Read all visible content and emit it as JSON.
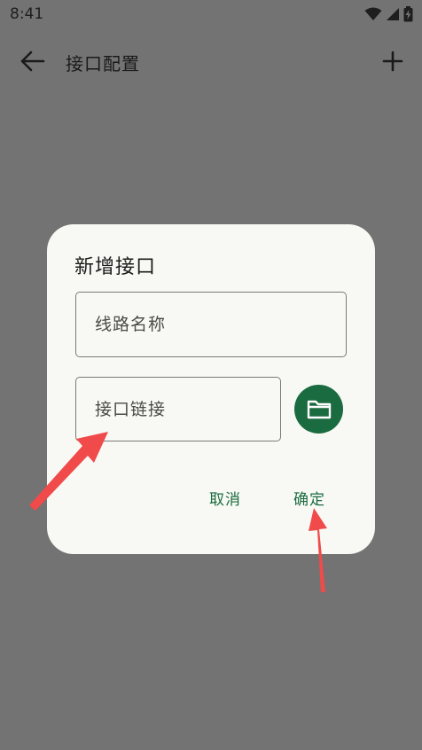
{
  "status_bar": {
    "time": "8:41",
    "icons": [
      "wifi-icon",
      "signal-icon",
      "battery-icon"
    ]
  },
  "app_bar": {
    "title": "接口配置",
    "back_icon": "arrow-left-icon",
    "add_icon": "plus-icon"
  },
  "dialog": {
    "title": "新增接口",
    "name_field": {
      "placeholder": "线路名称",
      "value": ""
    },
    "url_field": {
      "placeholder": "接口链接",
      "value": ""
    },
    "folder_button_icon": "folder-icon",
    "cancel_label": "取消",
    "confirm_label": "确定"
  },
  "colors": {
    "scrim": "#737373",
    "dialog_bg": "#f8f9f4",
    "accent": "#1a6b40",
    "annotation_arrow": "#f04a4a"
  }
}
